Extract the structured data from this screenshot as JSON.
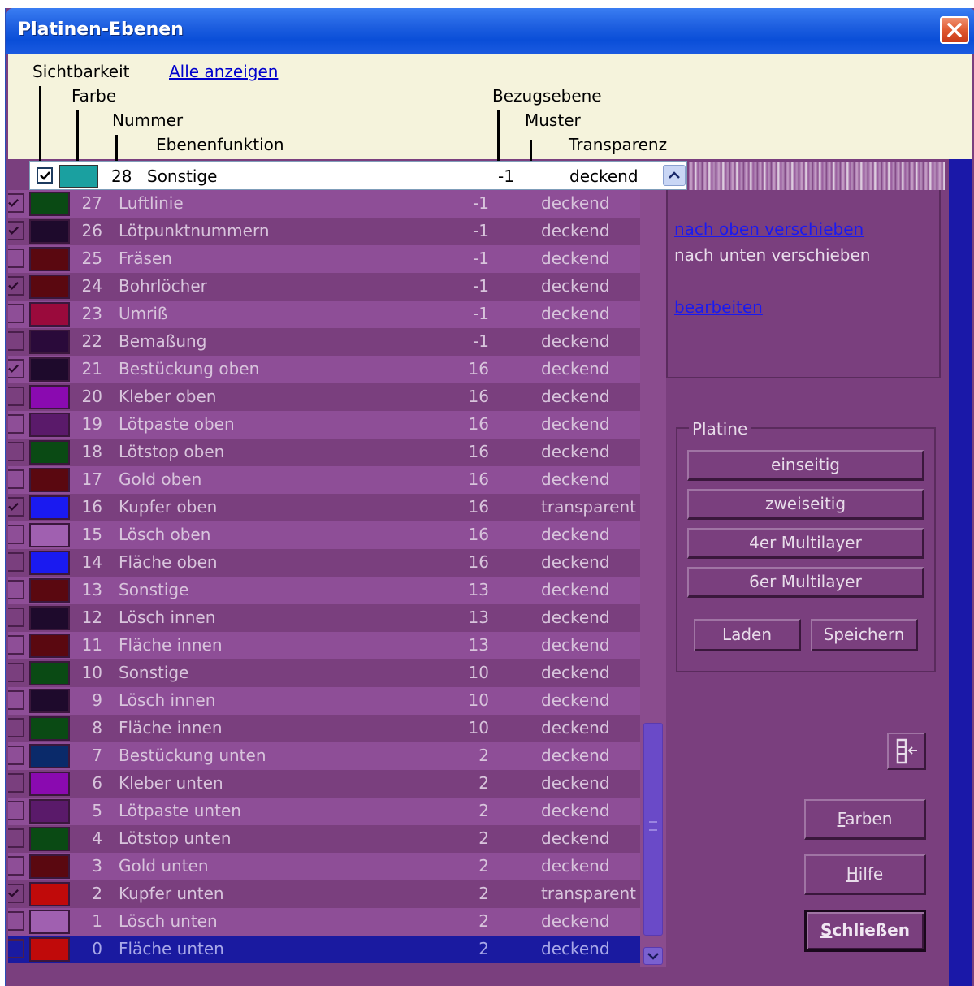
{
  "window": {
    "title": "Platinen-Ebenen"
  },
  "header": {
    "sichtbarkeit": "Sichtbarkeit",
    "alle_anzeigen": "Alle anzeigen",
    "farbe": "Farbe",
    "nummer": "Nummer",
    "ebenenfunktion": "Ebenenfunktion",
    "bezugsebene": "Bezugsebene",
    "muster": "Muster",
    "transparenz": "Transparenz"
  },
  "current": {
    "checked": true,
    "color": "#1aa0a0",
    "number": "28",
    "name": "Sonstige",
    "ref": "-1",
    "transparency": "deckend"
  },
  "layers": [
    {
      "checked": true,
      "color": "#0a4a14",
      "number": "27",
      "name": "Luftlinie",
      "ref": "-1",
      "transparency": "deckend"
    },
    {
      "checked": true,
      "color": "#1e0a2c",
      "number": "26",
      "name": "Lötpunktnummern",
      "ref": "-1",
      "transparency": "deckend"
    },
    {
      "checked": false,
      "color": "#5a0810",
      "number": "25",
      "name": "Fräsen",
      "ref": "-1",
      "transparency": "deckend"
    },
    {
      "checked": true,
      "color": "#5a0810",
      "number": "24",
      "name": "Bohrlöcher",
      "ref": "-1",
      "transparency": "deckend"
    },
    {
      "checked": false,
      "color": "#9a0a3c",
      "number": "23",
      "name": "Umriß",
      "ref": "-1",
      "transparency": "deckend"
    },
    {
      "checked": false,
      "color": "#2a0a3a",
      "number": "22",
      "name": "Bemaßung",
      "ref": "-1",
      "transparency": "deckend"
    },
    {
      "checked": true,
      "color": "#1e0a2c",
      "number": "21",
      "name": "Bestückung oben",
      "ref": "16",
      "transparency": "deckend"
    },
    {
      "checked": false,
      "color": "#8a0ab0",
      "number": "20",
      "name": "Kleber oben",
      "ref": "16",
      "transparency": "deckend"
    },
    {
      "checked": false,
      "color": "#5a1a6a",
      "number": "19",
      "name": "Lötpaste oben",
      "ref": "16",
      "transparency": "deckend"
    },
    {
      "checked": false,
      "color": "#0a4a14",
      "number": "18",
      "name": "Lötstop oben",
      "ref": "16",
      "transparency": "deckend"
    },
    {
      "checked": false,
      "color": "#5a0810",
      "number": "17",
      "name": "Gold oben",
      "ref": "16",
      "transparency": "deckend"
    },
    {
      "checked": true,
      "color": "#1a1af0",
      "number": "16",
      "name": "Kupfer oben",
      "ref": "16",
      "transparency": "transparent"
    },
    {
      "checked": false,
      "color": "#a060b0",
      "number": "15",
      "name": "Lösch oben",
      "ref": "16",
      "transparency": "deckend"
    },
    {
      "checked": false,
      "color": "#1a1af0",
      "number": "14",
      "name": "Fläche oben",
      "ref": "16",
      "transparency": "deckend"
    },
    {
      "checked": false,
      "color": "#5a0810",
      "number": "13",
      "name": "Sonstige",
      "ref": "13",
      "transparency": "deckend"
    },
    {
      "checked": false,
      "color": "#1e0a2c",
      "number": "12",
      "name": "Lösch innen",
      "ref": "13",
      "transparency": "deckend"
    },
    {
      "checked": false,
      "color": "#5a0810",
      "number": "11",
      "name": "Fläche innen",
      "ref": "13",
      "transparency": "deckend"
    },
    {
      "checked": false,
      "color": "#0a4a14",
      "number": "10",
      "name": "Sonstige",
      "ref": "10",
      "transparency": "deckend"
    },
    {
      "checked": false,
      "color": "#1e0a2c",
      "number": "9",
      "name": "Lösch innen",
      "ref": "10",
      "transparency": "deckend"
    },
    {
      "checked": false,
      "color": "#0a4a14",
      "number": "8",
      "name": "Fläche innen",
      "ref": "10",
      "transparency": "deckend"
    },
    {
      "checked": false,
      "color": "#0a2a6a",
      "number": "7",
      "name": "Bestückung unten",
      "ref": "2",
      "transparency": "deckend"
    },
    {
      "checked": false,
      "color": "#8a0ab0",
      "number": "6",
      "name": "Kleber unten",
      "ref": "2",
      "transparency": "deckend"
    },
    {
      "checked": false,
      "color": "#5a1a6a",
      "number": "5",
      "name": "Lötpaste unten",
      "ref": "2",
      "transparency": "deckend"
    },
    {
      "checked": false,
      "color": "#0a4a14",
      "number": "4",
      "name": "Lötstop unten",
      "ref": "2",
      "transparency": "deckend"
    },
    {
      "checked": false,
      "color": "#5a0810",
      "number": "3",
      "name": "Gold unten",
      "ref": "2",
      "transparency": "deckend"
    },
    {
      "checked": true,
      "color": "#c00a0a",
      "number": "2",
      "name": "Kupfer unten",
      "ref": "2",
      "transparency": "transparent"
    },
    {
      "checked": false,
      "color": "#a060b0",
      "number": "1",
      "name": "Lösch unten",
      "ref": "2",
      "transparency": "deckend"
    },
    {
      "checked": false,
      "color": "#c00a0a",
      "number": "0",
      "name": "Fläche unten",
      "ref": "2",
      "transparency": "deckend",
      "selected": true
    }
  ],
  "side": {
    "move_up": "nach oben verschieben",
    "move_down": "nach unten verschieben",
    "edit": "bearbeiten"
  },
  "platine": {
    "label": "Platine",
    "einseitig": "einseitig",
    "zweiseitig": "zweiseitig",
    "multilayer4": "4er Multilayer",
    "multilayer6": "6er Multilayer",
    "laden": "Laden",
    "speichern": "Speichern"
  },
  "buttons": {
    "farben_first": "F",
    "farben_rest": "arben",
    "hilfe_first": "H",
    "hilfe_rest": "ilfe",
    "schliessen_first": "S",
    "schliessen_rest": "chließen"
  }
}
